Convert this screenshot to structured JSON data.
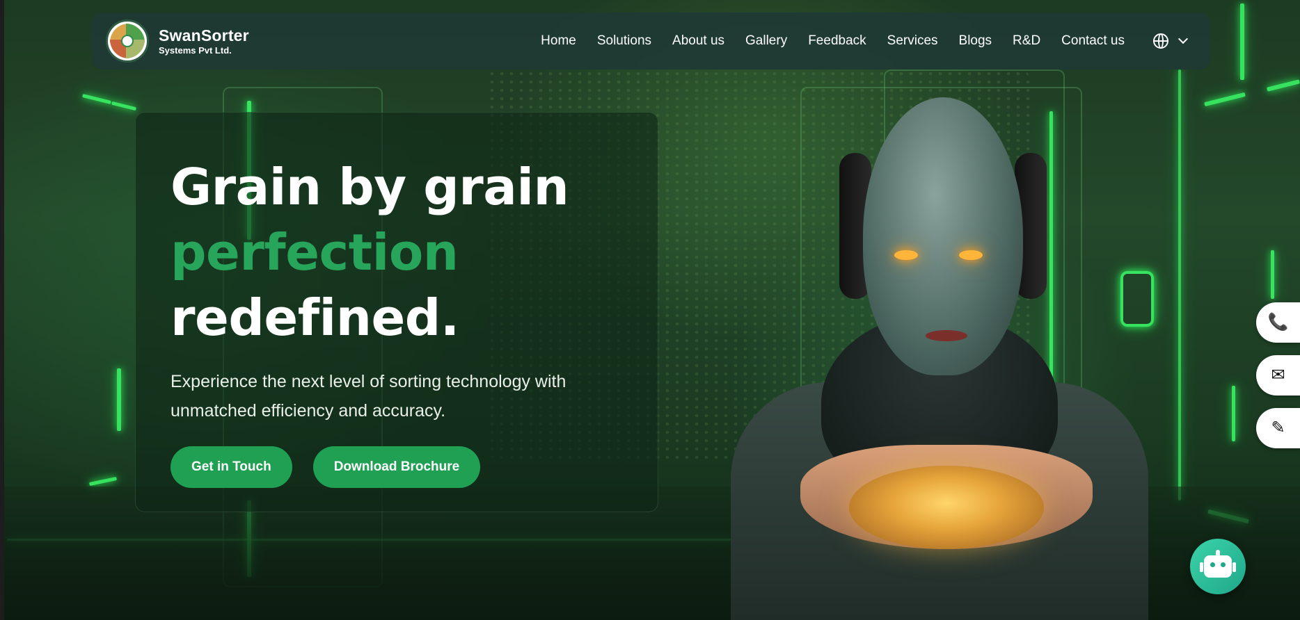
{
  "brand": {
    "name": "SwanSorter",
    "subtitle": "Systems Pvt Ltd."
  },
  "nav": {
    "items": [
      {
        "label": "Home"
      },
      {
        "label": "Solutions"
      },
      {
        "label": "About us"
      },
      {
        "label": "Gallery"
      },
      {
        "label": "Feedback"
      },
      {
        "label": "Services"
      },
      {
        "label": "Blogs"
      },
      {
        "label": "R&D"
      },
      {
        "label": "Contact us"
      }
    ],
    "language_icon": "globe-icon",
    "dropdown_icon": "chevron-down-icon"
  },
  "hero": {
    "headline_line1": "Grain by grain",
    "headline_line2": "perfection",
    "headline_line3": "redefined.",
    "description": "Experience the next level of sorting technology with unmatched efficiency and accuracy.",
    "primary_button": "Get in Touch",
    "secondary_button": "Download Brochure"
  },
  "side_actions": [
    {
      "icon": "phone-icon",
      "glyph": "📞"
    },
    {
      "icon": "mail-icon",
      "glyph": "✉"
    },
    {
      "icon": "pencil-icon",
      "glyph": "✎"
    }
  ],
  "chatbot": {
    "icon": "robot-icon"
  },
  "colors": {
    "accent_green": "#27a55a",
    "button_green": "#20a052",
    "navbar_bg": "#1e3a34",
    "chatbot_teal": "#2bbf98"
  }
}
